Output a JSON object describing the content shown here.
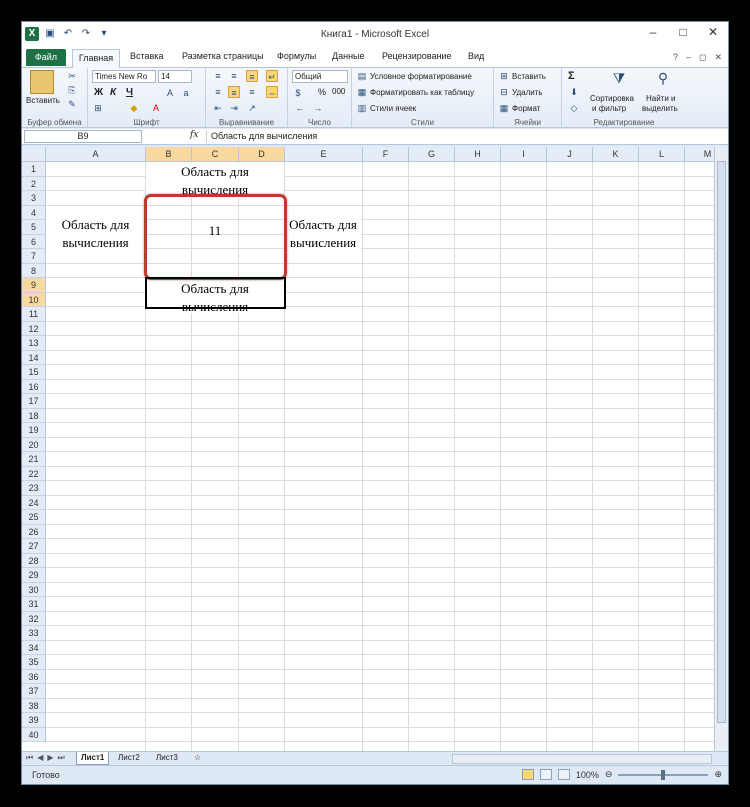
{
  "window": {
    "title": "Книга1 - Microsoft Excel",
    "controls": [
      "–",
      "□",
      "✕"
    ]
  },
  "ribbon_tabs": [
    "Файл",
    "Главная",
    "Вставка",
    "Разметка страницы",
    "Формулы",
    "Данные",
    "Рецензирование",
    "Вид"
  ],
  "ribbon": {
    "clipboard": {
      "paste": "Вставить",
      "label": "Буфер обмена"
    },
    "font": {
      "name": "Times New Ro",
      "size": "14",
      "bold": "Ж",
      "italic": "К",
      "underline": "Ч",
      "label": "Шрифт"
    },
    "alignment": {
      "label": "Выравнивание"
    },
    "number": {
      "format": "Общий",
      "percent": "%",
      "thousands": "000",
      "label": "Число"
    },
    "styles": {
      "conditional": "Условное форматирование",
      "as_table": "Форматировать как таблицу",
      "cell_styles": "Стили ячеек",
      "label": "Стили"
    },
    "cells": {
      "insert": "Вставить",
      "delete": "Удалить",
      "format": "Формат",
      "label": "Ячейки"
    },
    "editing": {
      "sigma": "Σ",
      "sort": "Сортировка",
      "sort2": "и фильтр",
      "find": "Найти и",
      "find2": "выделить",
      "label": "Редактирование"
    }
  },
  "formula_bar": {
    "name_box": "B9",
    "fx": "fx",
    "content": "Область для вычисления"
  },
  "columns": [
    "A",
    "B",
    "C",
    "D",
    "E",
    "F",
    "G",
    "H",
    "I",
    "J",
    "K",
    "L",
    "M"
  ],
  "rows": [
    "1",
    "2",
    "3",
    "4",
    "5",
    "6",
    "7",
    "8",
    "9",
    "10",
    "11",
    "12",
    "13",
    "14",
    "15",
    "16",
    "17",
    "18",
    "19",
    "20",
    "21",
    "22",
    "23",
    "24",
    "25",
    "26",
    "27",
    "28",
    "29",
    "30",
    "31",
    "32",
    "33",
    "34",
    "35",
    "36",
    "37",
    "38",
    "39",
    "40"
  ],
  "cells": {
    "b1_line1": "Область для",
    "b1_line2": "вычисления",
    "a5_line1": "Область для",
    "a5_line2": "вычисления",
    "center_value": "11",
    "e5_line1": "Область для",
    "e5_line2": "вычисления",
    "b9_line1": "Область для",
    "b9_line2": "вычисления"
  },
  "sheets": [
    "Лист1",
    "Лист2",
    "Лист3"
  ],
  "status": {
    "text": "Готово",
    "zoom": "100%"
  },
  "colors": {
    "excel_green": "#1e7145",
    "highlight_box": "#c0392b",
    "selected_header": "#f9d99f"
  }
}
